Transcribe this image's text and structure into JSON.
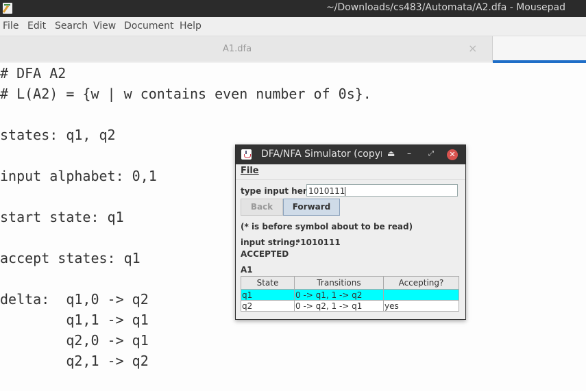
{
  "window": {
    "title": "~/Downloads/cs483/Automata/A2.dfa - Mousepad"
  },
  "menubar": {
    "items": [
      "File",
      "Edit",
      "Search",
      "View",
      "Document",
      "Help"
    ]
  },
  "tabs": {
    "first": {
      "label": "A1.dfa",
      "close": "×"
    }
  },
  "editor": {
    "lines": [
      "# DFA A2",
      "# L(A2) = {w | w contains even number of 0s}.",
      "",
      "states: q1, q2",
      "",
      "input alphabet: 0,1",
      "",
      "start state: q1",
      "",
      "accept states: q1",
      "",
      "delta:  q1,0 -> q2",
      "        q1,1 -> q1",
      "        q2,0 -> q1",
      "        q2,1 -> q2"
    ]
  },
  "simulator": {
    "title": "DFA/NFA Simulator (copyrigl",
    "menu_file": "File",
    "input_label": "type input here:",
    "input_value": "1010111",
    "back_label": "Back",
    "forward_label": "Forward",
    "hint": "(* is before symbol about to be read)",
    "input_string_label": "input string:",
    "input_string_value": "*1010111",
    "status": "ACCEPTED",
    "automaton_name": "A1",
    "table": {
      "headers": [
        "State",
        "Transitions",
        "Accepting?"
      ],
      "rows": [
        {
          "state": "q1",
          "transitions": "0 -> q1, 1 -> q2",
          "accepting": ""
        },
        {
          "state": "q2",
          "transitions": "0 -> q2, 1 -> q1",
          "accepting": "yes"
        }
      ]
    },
    "colors": {
      "current_row": "#00ffff",
      "close_button": "#d9534f"
    }
  }
}
